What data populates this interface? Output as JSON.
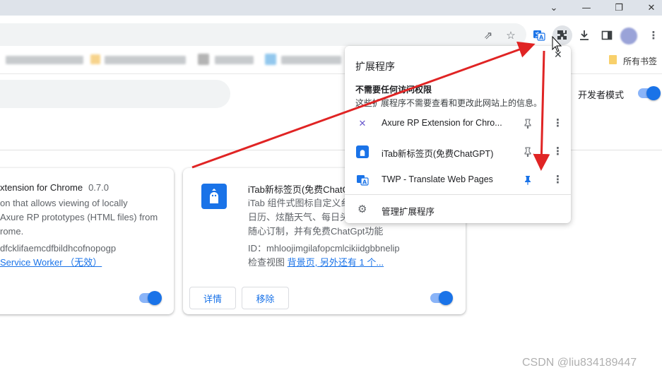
{
  "window": {
    "minimize_icon": "minimize-icon",
    "restore_icon": "restore-icon",
    "close_icon": "close-icon",
    "tabs_menu_icon": "chevron-down-icon"
  },
  "toolbar": {
    "icons": [
      "share-icon",
      "star-icon",
      "translate-icon",
      "extensions-puzzle-icon",
      "download-icon",
      "side-panel-icon",
      "profile-avatar",
      "menu-dots-icon"
    ]
  },
  "bookmarks": {
    "other_bookmarks": "所有书签"
  },
  "page": {
    "developer_mode_label": "开发者模式",
    "developer_mode_on": true
  },
  "cards": [
    {
      "title": "xtension for Chrome",
      "version": "0.7.0",
      "desc_lines": [
        "on that allows viewing of locally",
        "Axure RP prototypes (HTML files) from",
        "rome."
      ],
      "id_text": "dfcklifaemcdfbildhcofnopogp",
      "link": "Service Worker （无效）",
      "enabled": true
    },
    {
      "title": "iTab新标签页(免费ChatG",
      "desc_lines": [
        "iTab 组件式图标自定义纟",
        "日历、炫酷天气、每日头",
        "随心订制，并有免费ChatGpt功能"
      ],
      "id_text": "ID：mhloojimgilafopcmlcikiidgbbnelip",
      "inspect_label": "检查视图",
      "inspect_link": "背景页, 另外还有 1 个...",
      "details_button": "详情",
      "remove_button": "移除",
      "enabled": true
    }
  ],
  "popup": {
    "title": "扩展程序",
    "section_title": "不需要任何访问权限",
    "section_desc": "这些扩展程序不需要查看和更改此网站上的信息。",
    "extensions": [
      {
        "name": "Axure RP Extension for Chro...",
        "icon": "axure-icon",
        "pinned": false
      },
      {
        "name": "iTab新标签页(免费ChatGPT)",
        "icon": "itab-icon",
        "pinned": false
      },
      {
        "name": "TWP - Translate Web Pages",
        "icon": "translate-icon",
        "pinned": true
      }
    ],
    "manage_label": "管理扩展程序"
  },
  "colors": {
    "accent": "#1a73e8",
    "annotation_arrow": "#e02424"
  },
  "watermark": "CSDN @liu834189447"
}
